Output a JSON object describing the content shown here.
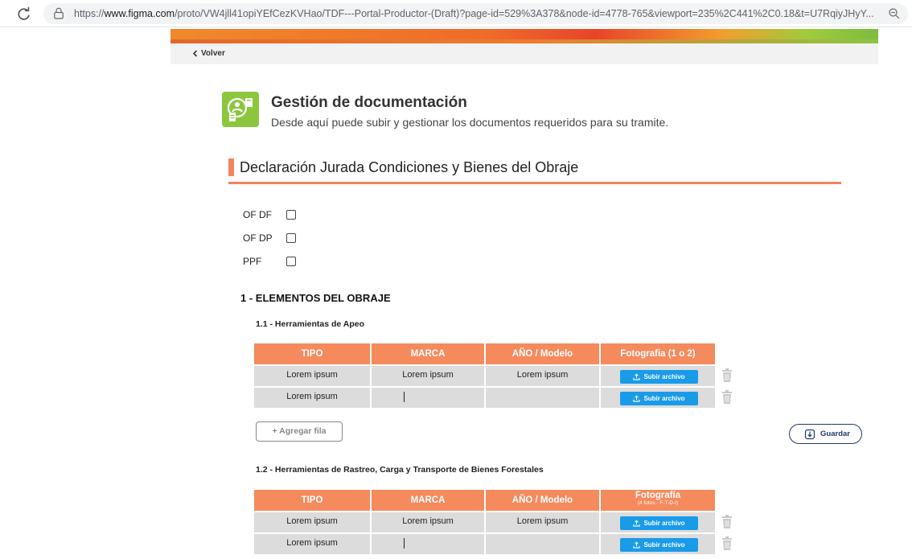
{
  "browser": {
    "url_prefix": "https://",
    "url_host": "www.figma.com",
    "url_path": "/proto/VW4jll41opiYEfCezKVHao/TDF---Portal-Productor-(Draft)?page-id=529%3A378&node-id=4778-765&viewport=235%2C441%2C0.18&t=U7RqiyJHyY..."
  },
  "nav": {
    "back_label": "Volver"
  },
  "header": {
    "title": "Gestión de documentación",
    "subtitle": "Desde aquí puede subir y gestionar los documentos requeridos para su tramite."
  },
  "section": {
    "title": "Declaración Jurada Condiciones y Bienes del Obraje"
  },
  "checkboxes": [
    {
      "label": "OF DF",
      "checked": false
    },
    {
      "label": "OF DP",
      "checked": false
    },
    {
      "label": "PPF",
      "checked": false
    }
  ],
  "elements": {
    "heading": "1 - ELEMENTOS DEL OBRAJE",
    "sub1": "1.1 - Herramientas de Apeo",
    "sub2": "1.2 - Herramientas de Rastreo, Carga y Transporte de Bienes Forestales"
  },
  "table1": {
    "headers": [
      "TIPO",
      "MARCA",
      "AÑO / Modelo",
      "Fotografia (1 o 2)"
    ],
    "rows": [
      [
        "Lorem ipsum",
        "Lorem ipsum",
        "Lorem ipsum"
      ],
      [
        "Lorem ipsum",
        "",
        ""
      ]
    ],
    "upload_label": "Subir archivo"
  },
  "table2": {
    "headers": [
      "TIPO",
      "MARCA",
      "AÑO / Modelo",
      "Fotografía"
    ],
    "photo_note": "(4 fotos - F-T-D-I)",
    "rows": [
      [
        "Lorem ipsum",
        "Lorem ipsum",
        "Lorem ipsum"
      ],
      [
        "Lorem ipsum",
        "",
        ""
      ]
    ],
    "upload_label": "Subir archivo"
  },
  "actions": {
    "add_row_label": "+ Agregar fila",
    "save_label": "Guardar"
  },
  "colors": {
    "accent_orange": "#f58a5d",
    "upload_blue": "#1a9be8",
    "icon_green": "#8cc63f",
    "save_navy": "#1f3a6e"
  }
}
